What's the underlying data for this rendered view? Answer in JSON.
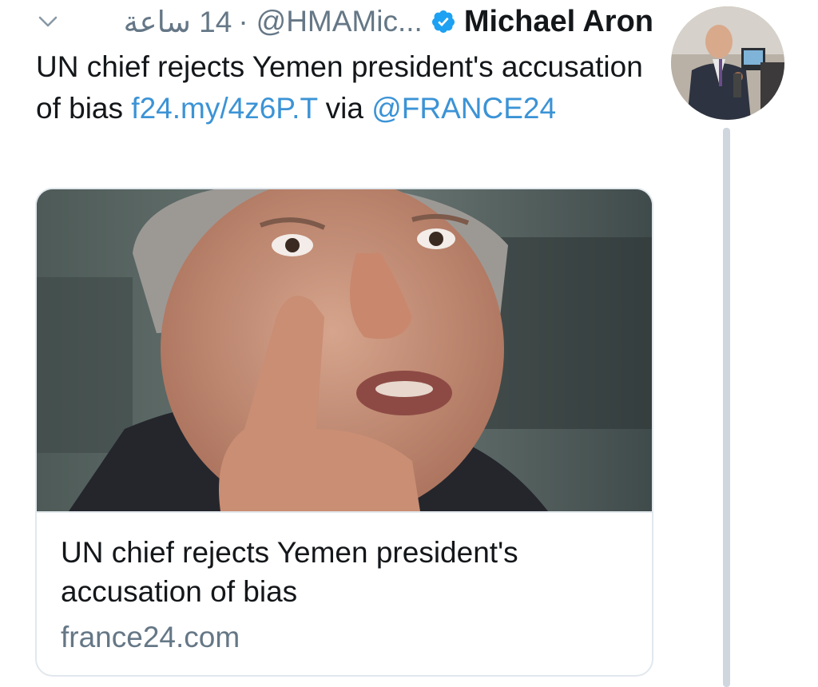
{
  "tweet": {
    "author_name": "Michael Aron",
    "handle": "@HMAMic...",
    "time": "14 ساعة",
    "separator": "·",
    "text_before": "UN chief rejects Yemen president's accusation of bias ",
    "link": "f24.my/4z6P.T",
    "text_mid": " via ",
    "mention": "@FRANCE24"
  },
  "card": {
    "title": "UN chief rejects Yemen president's accusation of bias",
    "domain": "france24.com"
  },
  "icons": {
    "menu": "chevron-down-icon",
    "verified": "verified-badge-icon"
  },
  "colors": {
    "link": "#3b93d6",
    "muted": "#657786",
    "verified": "#1da1f2",
    "thread_line": "#cfd6dd"
  }
}
